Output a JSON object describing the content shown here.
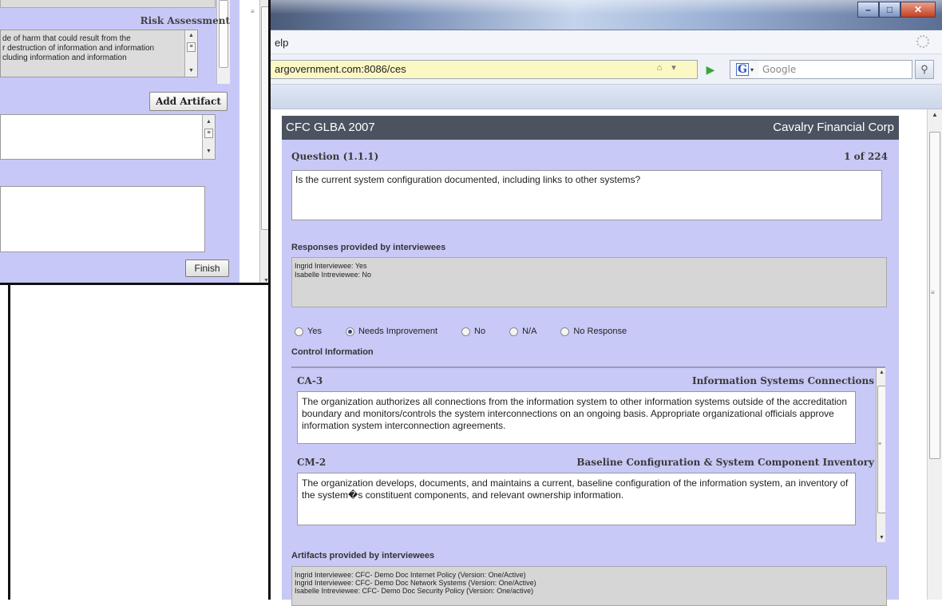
{
  "back_window": {
    "risk_heading": "Risk Assessment",
    "risk_text_lines": [
      "de of harm that could result from the",
      "r destruction of information and information",
      "cluding information and information"
    ],
    "add_artifact_label": "Add Artifact",
    "finish_label": "Finish"
  },
  "browser": {
    "menu_help": "elp",
    "url": "argovernment.com:8086/ces",
    "search_placeholder": "Google"
  },
  "assessment": {
    "title": "CFC GLBA 2007",
    "organization": "Cavalry Financial Corp",
    "question_label": "Question (1.1.1)",
    "question_count": "1 of 224",
    "question_text": "Is the current system configuration documented, including links to other systems?",
    "responses_heading": "Responses provided by interviewees",
    "responses": [
      "Ingrid Interviewee: Yes",
      "Isabelle Intreviewee: No"
    ],
    "options": {
      "yes": "Yes",
      "needs_improvement": "Needs Improvement",
      "no": "No",
      "na": "N/A",
      "no_response": "No Response"
    },
    "selected_option": "Needs Improvement",
    "control_heading": "Control Information",
    "controls": [
      {
        "code": "CA-3",
        "name": "Information Systems Connections",
        "description": "The organization authorizes all connections from the information system to other information systems outside of the accreditation boundary and monitors/controls the system interconnections on an ongoing basis. Appropriate organizational officials approve information system interconnection agreements."
      },
      {
        "code": "CM-2",
        "name": "Baseline Configuration & System Component Inventory",
        "description": "The organization develops, documents, and maintains a current, baseline configuration of the information system, an inventory of the system�s constituent components, and relevant ownership information."
      }
    ],
    "artifacts_heading": "Artifacts provided by interviewees",
    "artifacts": [
      "Ingrid Interviewee: CFC- Demo Doc Internet Policy (Version: One/Active)",
      "Ingrid Interviewee: CFC- Demo Doc Network Systems (Version: One/Active)",
      "Isabelle Intreviewee: CFC- Demo Doc Security Policy (Version: One/active)"
    ]
  }
}
